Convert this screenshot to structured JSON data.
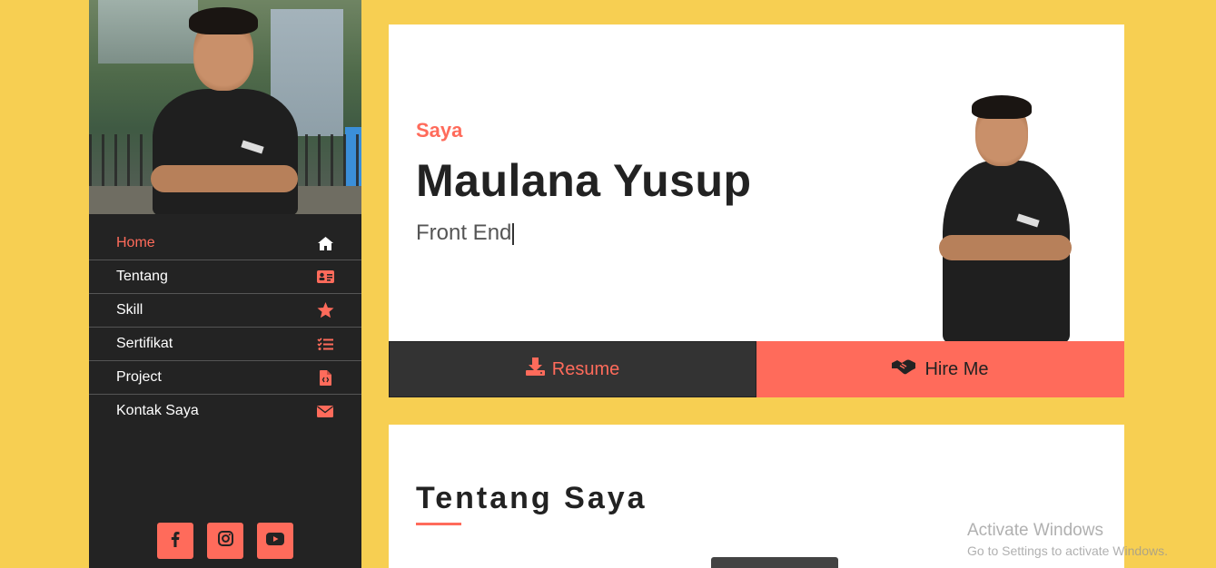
{
  "sidebar": {
    "nav": [
      {
        "label": "Home",
        "icon": "home-icon",
        "active": true
      },
      {
        "label": "Tentang",
        "icon": "id-card-icon",
        "active": false
      },
      {
        "label": "Skill",
        "icon": "star-icon",
        "active": false
      },
      {
        "label": "Sertifikat",
        "icon": "list-check-icon",
        "active": false
      },
      {
        "label": "Project",
        "icon": "file-icon",
        "active": false
      },
      {
        "label": "Kontak Saya",
        "icon": "envelope-icon",
        "active": false
      }
    ],
    "social": [
      {
        "icon": "facebook-icon"
      },
      {
        "icon": "instagram-icon"
      },
      {
        "icon": "youtube-icon"
      }
    ]
  },
  "hero": {
    "intro": "Saya",
    "name": "Maulana Yusup",
    "role": "Front End",
    "resume_label": "Resume",
    "hire_label": "Hire Me"
  },
  "about": {
    "title": "Tentang Saya"
  },
  "watermark": {
    "title": "Activate Windows",
    "subtitle": "Go to Settings to activate Windows."
  },
  "colors": {
    "background": "#f7cf52",
    "accent": "#ff6b5b",
    "sidebar": "#232323"
  }
}
